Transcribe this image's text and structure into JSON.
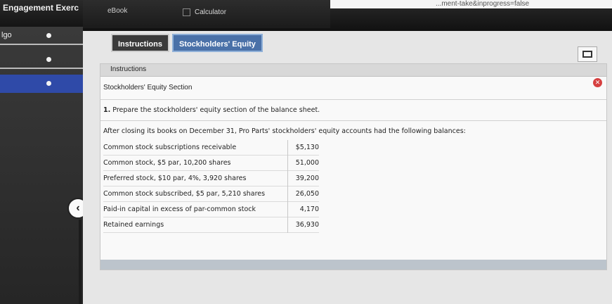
{
  "window": {
    "url_fragment": "...ment-take&inprogress=false",
    "app_title": "Engagement Exerc"
  },
  "toolbar": {
    "ebook_label": "eBook",
    "calculator_label": "Calculator"
  },
  "sidebar": {
    "items": [
      {
        "label": "lgo"
      },
      {
        "label": ""
      },
      {
        "label": ""
      }
    ]
  },
  "tabs": [
    {
      "label": "Instructions"
    },
    {
      "label": "Stockholders' Equity"
    }
  ],
  "panel": {
    "header": "Instructions",
    "section_title": "Stockholders' Equity Section",
    "question_number": "1.",
    "question_text": "Prepare the stockholders' equity section of the balance sheet.",
    "intro": "After closing its books on December 31, Pro Parts' stockholders' equity accounts had the following balances:",
    "accounts": [
      {
        "name": "Common stock subscriptions receivable",
        "amount": "$5,130"
      },
      {
        "name": "Common stock, $5 par, 10,200 shares",
        "amount": "51,000"
      },
      {
        "name": "Preferred stock, $10 par, 4%, 3,920 shares",
        "amount": "39,200"
      },
      {
        "name": "Common stock subscribed, $5 par, 5,210 shares",
        "amount": "26,050"
      },
      {
        "name": "Paid-in capital in excess of par-common stock",
        "amount": "4,170"
      },
      {
        "name": "Retained earnings",
        "amount": "36,930"
      }
    ]
  },
  "colors": {
    "active_nav": "#2f4aa8",
    "equity_tab": "#4a71a8",
    "close_button": "#d64040"
  }
}
